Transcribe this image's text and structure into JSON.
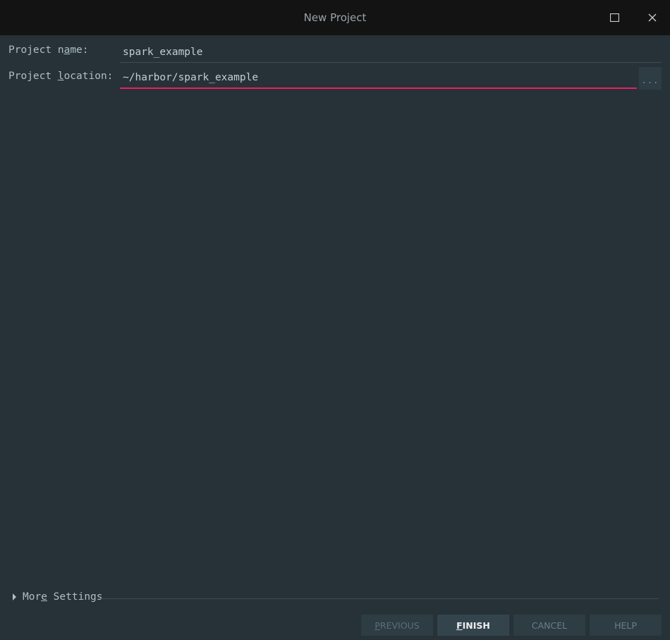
{
  "window": {
    "title": "New Project"
  },
  "form": {
    "project_name": {
      "label_before": "Project n",
      "label_mnemonic": "a",
      "label_after": "me:",
      "value": "spark_example"
    },
    "project_location": {
      "label_before": "Project ",
      "label_mnemonic": "l",
      "label_after": "ocation:",
      "value": "~/harbor/spark_example",
      "browse_label": "..."
    }
  },
  "more_settings": {
    "label_before": "Mor",
    "label_mnemonic": "e",
    "label_after": " Settings"
  },
  "footer": {
    "previous": {
      "mnemonic": "P",
      "rest": "REVIOUS"
    },
    "finish": {
      "mnemonic": "F",
      "rest": "INISH"
    },
    "cancel": "CANCEL",
    "help": "HELP"
  },
  "icons": {
    "maximize": "maximize-icon",
    "close": "close-icon",
    "expand": "triangle-right-icon"
  },
  "colors": {
    "background": "#263238",
    "titlebar": "#131313",
    "accent": "#e91e63",
    "button": "#2e3c43"
  }
}
